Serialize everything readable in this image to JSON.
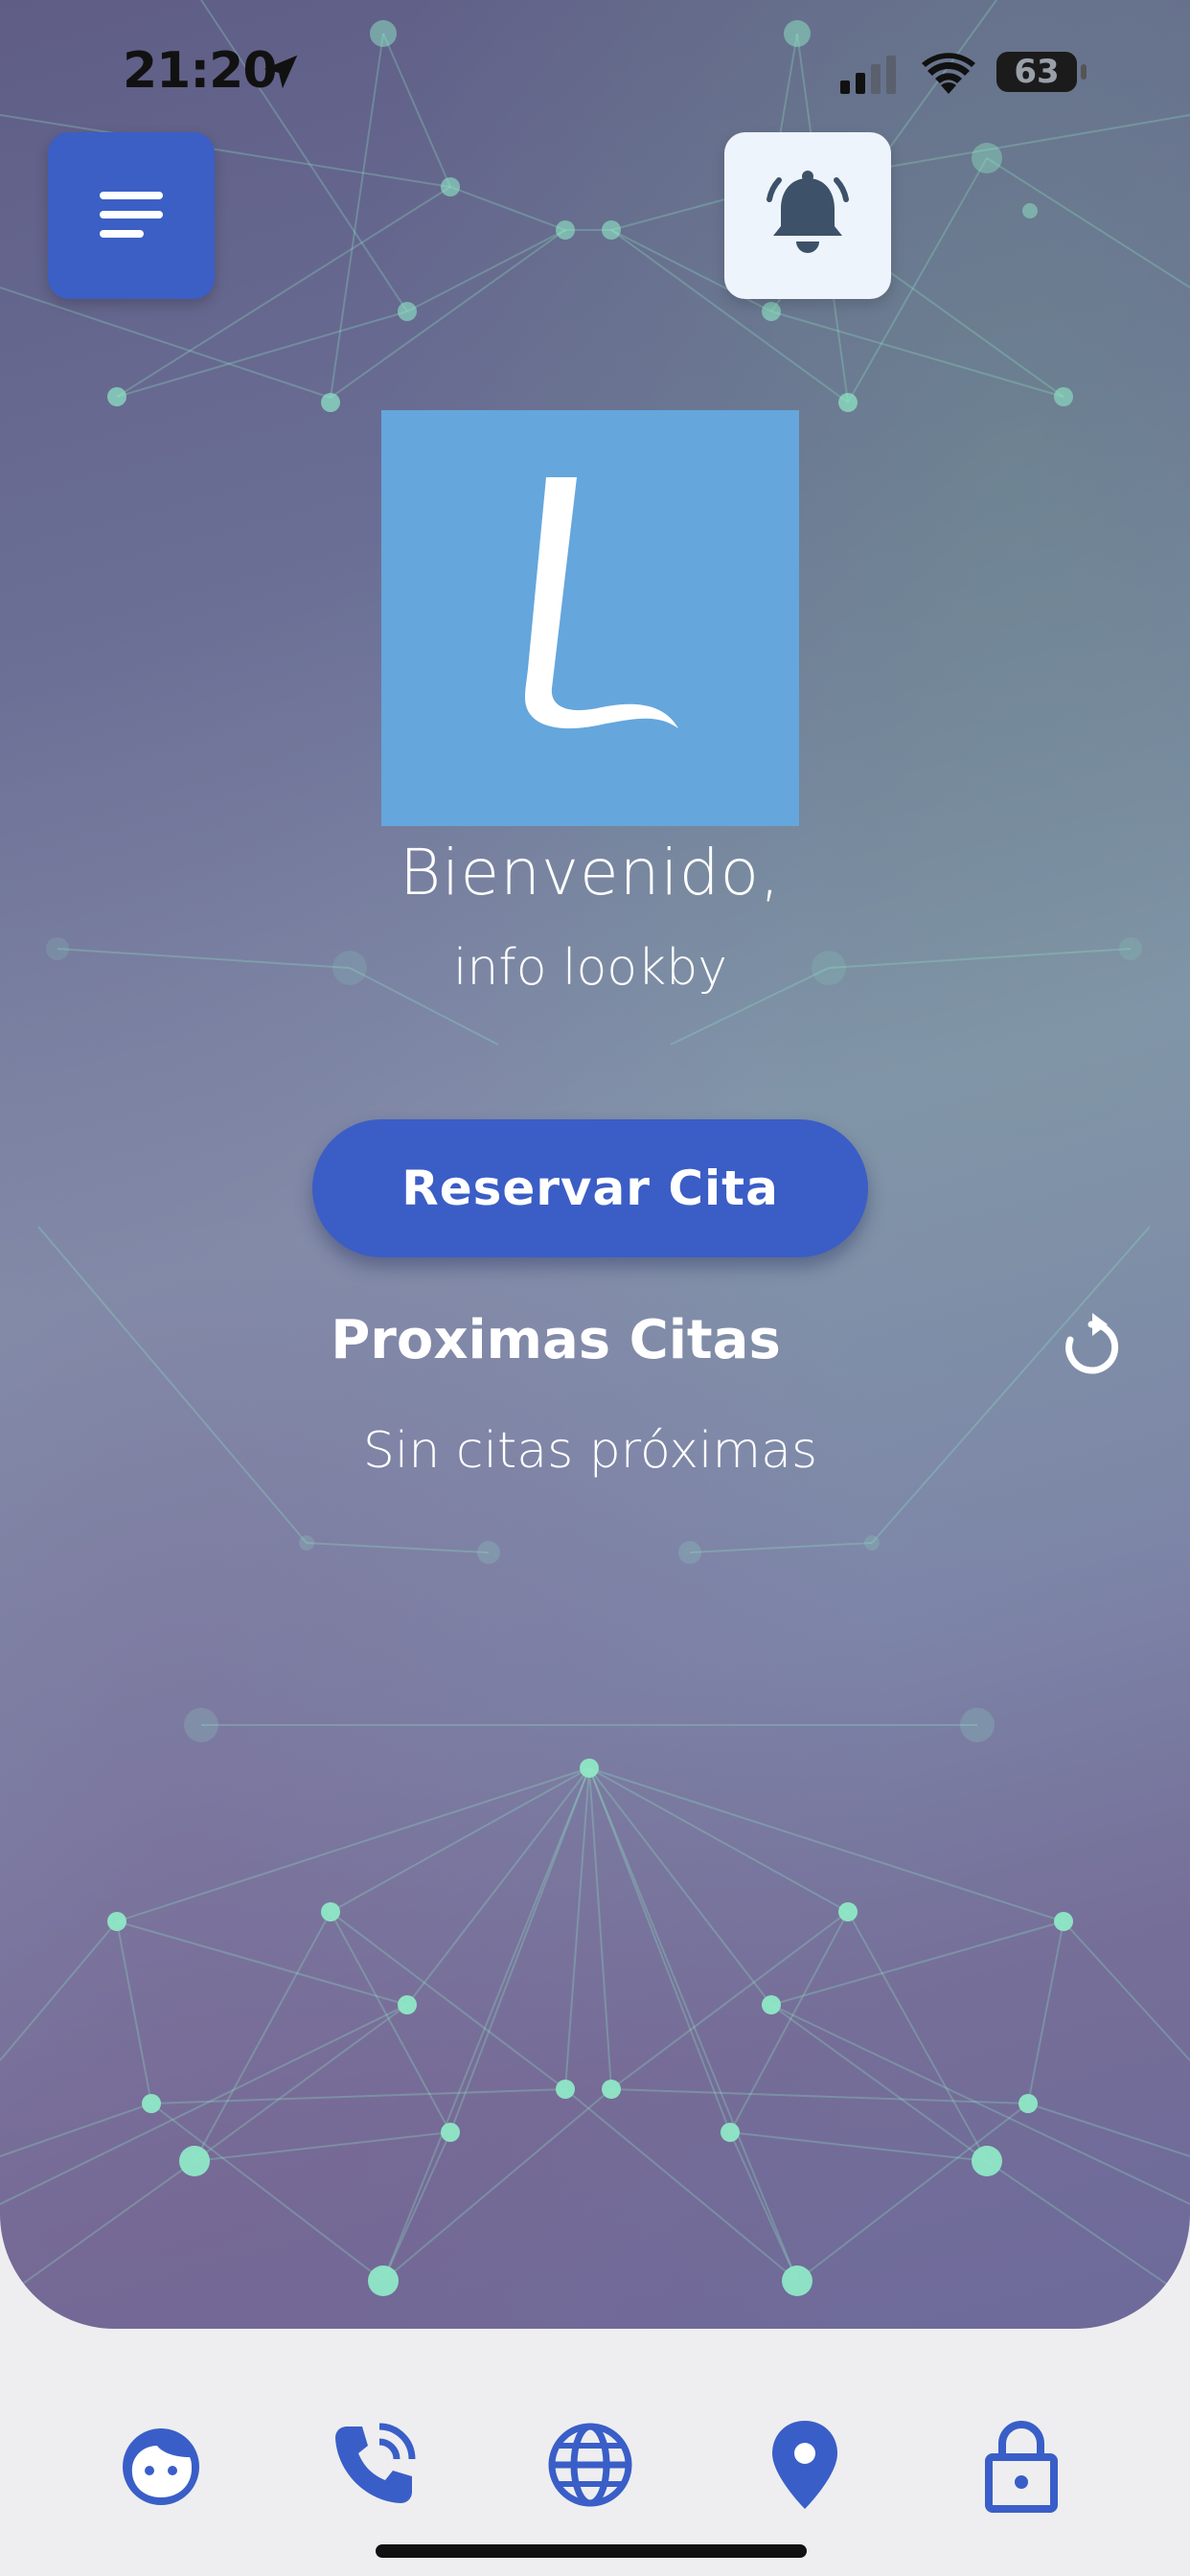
{
  "status_bar": {
    "time": "21:20",
    "battery": "63",
    "icons": [
      "location-arrow-icon",
      "signal-icon",
      "wifi-icon",
      "battery-icon"
    ]
  },
  "header": {
    "menu_icon": "hamburger-menu-icon",
    "notifications_icon": "bell-icon"
  },
  "logo": {
    "letter": "L"
  },
  "welcome": {
    "greeting": "Bienvenido,",
    "user": "info lookby"
  },
  "actions": {
    "book_label": "Reservar Cita"
  },
  "appointments": {
    "title": "Proximas Citas",
    "refresh_icon": "refresh-icon",
    "empty_message": "Sin citas próximas"
  },
  "bottom_nav": {
    "items": [
      {
        "icon": "face-icon"
      },
      {
        "icon": "phone-call-icon"
      },
      {
        "icon": "globe-icon"
      },
      {
        "icon": "map-pin-icon"
      },
      {
        "icon": "lock-icon"
      }
    ]
  },
  "colors": {
    "primary": "#3b5dc6",
    "logo_background": "#65a6dc",
    "network_nodes": "#8fe8c6",
    "nav_icons": "#3a5ec8"
  }
}
